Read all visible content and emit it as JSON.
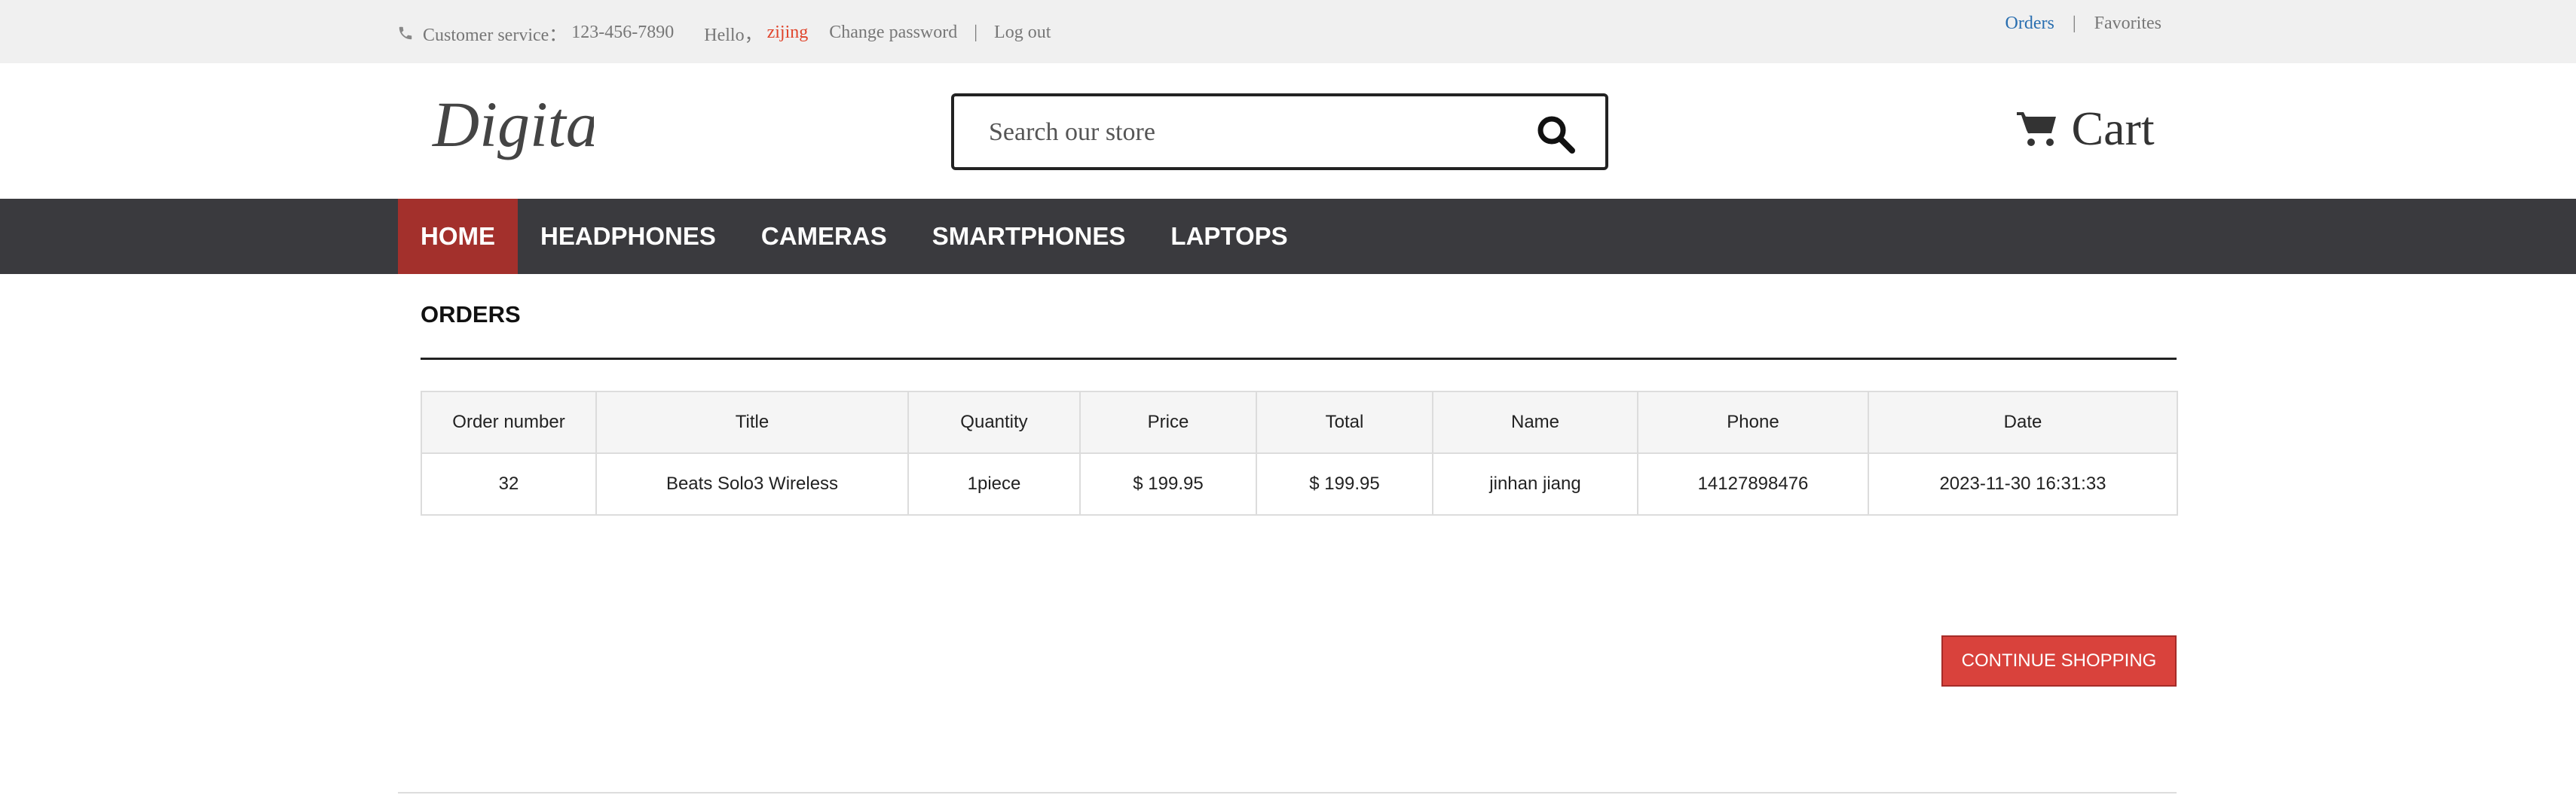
{
  "topbar": {
    "customer_service_label": "Customer service：",
    "customer_service_phone": "123-456-7890",
    "hello_label": "Hello，",
    "username": "zijing",
    "change_password": "Change password",
    "separator": "|",
    "log_out": "Log out",
    "orders_link": "Orders",
    "favorites_link": "Favorites"
  },
  "header": {
    "logo_text": "Digital",
    "search_placeholder": "Search our store",
    "cart_label": "Cart"
  },
  "nav": {
    "items": [
      "HOME",
      "HEADPHONES",
      "CAMERAS",
      "SMARTPHONES",
      "LAPTOPS"
    ],
    "active_index": 0
  },
  "orders": {
    "title": "ORDERS",
    "columns": [
      "Order number",
      "Title",
      "Quantity",
      "Price",
      "Total",
      "Name",
      "Phone",
      "Date"
    ],
    "rows": [
      [
        "32",
        "Beats Solo3 Wireless",
        "1piece",
        "$ 199.95",
        "$ 199.95",
        "jinhan jiang",
        "14127898476",
        "2023-11-30 16:31:33"
      ]
    ],
    "continue_button": "CONTINUE SHOPPING"
  },
  "colors": {
    "accent_red": "#a3302c",
    "button_red": "#d9423c",
    "nav_bg": "#3a3a3e",
    "link_blue": "#2a6fb0",
    "username_orange": "#e0442b"
  },
  "icons": {
    "phone": "phone-icon",
    "search": "search-icon",
    "cart": "cart-icon"
  }
}
